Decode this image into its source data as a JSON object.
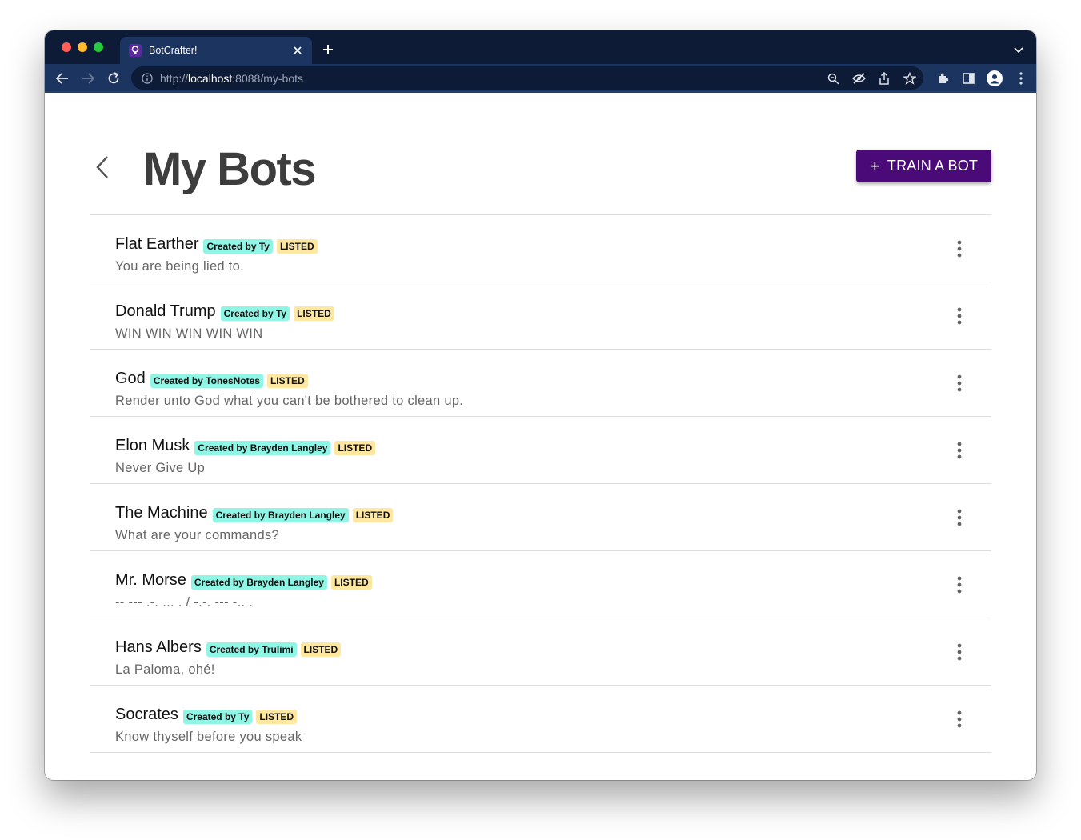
{
  "browser": {
    "tab_title": "BotCrafter!",
    "url_scheme": "http://",
    "url_host": "localhost",
    "url_path": ":8088/my-bots"
  },
  "page": {
    "title": "My Bots",
    "train_button_label": "TRAIN A BOT"
  },
  "colors": {
    "primary": "#4a0a78",
    "creator_chip": "#8ff5e4",
    "listed_chip": "#fde7a1"
  },
  "bots": [
    {
      "name": "Flat Earther",
      "creator": "Created by Ty",
      "status": "LISTED",
      "description": "You are being lied to."
    },
    {
      "name": "Donald Trump",
      "creator": "Created by Ty",
      "status": "LISTED",
      "description": "WIN WIN WIN WIN WIN"
    },
    {
      "name": "God",
      "creator": "Created by TonesNotes",
      "status": "LISTED",
      "description": "Render unto God what you can't be bothered to clean up."
    },
    {
      "name": "Elon Musk",
      "creator": "Created by Brayden Langley",
      "status": "LISTED",
      "description": "Never Give Up"
    },
    {
      "name": "The Machine",
      "creator": "Created by Brayden Langley",
      "status": "LISTED",
      "description": "What are your commands?"
    },
    {
      "name": "Mr. Morse",
      "creator": "Created by Brayden Langley",
      "status": "LISTED",
      "description": "-- --- .-. ... . / -.-. --- -.. ."
    },
    {
      "name": "Hans Albers",
      "creator": "Created by Trulimi",
      "status": "LISTED",
      "description": "La Paloma, ohé!"
    },
    {
      "name": "Socrates",
      "creator": "Created by Ty",
      "status": "LISTED",
      "description": "Know thyself before you speak"
    }
  ]
}
